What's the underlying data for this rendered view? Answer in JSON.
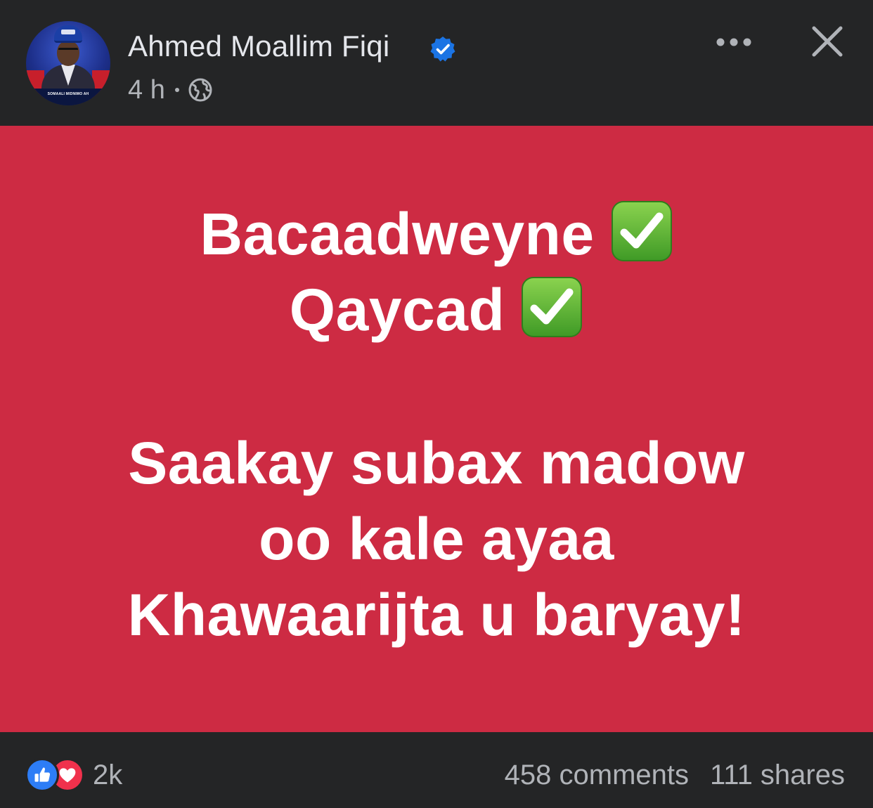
{
  "header": {
    "author_name": "Ahmed Moallim Fiqi",
    "timestamp": "4 h",
    "privacy_icon": "globe-icon",
    "verified_icon": "verified-badge-icon",
    "more_icon": "more-options-icon",
    "close_icon": "close-icon",
    "avatar_banner": "SOMAALI MIDNIMO AH"
  },
  "post": {
    "background_color": "#cd2b43",
    "text_color": "#ffffff",
    "lines": [
      "Bacaadweyne",
      "Qaycad",
      "Saakay subax madow",
      "oo kale ayaa",
      "Khawaarijta u baryay!"
    ],
    "check_icon": "check-mark-button-icon"
  },
  "footer": {
    "reactions": [
      "like-icon",
      "love-icon"
    ],
    "reaction_count": "2k",
    "comments": "458 comments",
    "shares": "111 shares"
  },
  "colors": {
    "page_background": "#242526",
    "primary_text": "#e4e6eb",
    "secondary_text": "#b0b3b8",
    "verified_blue": "#1b74e4",
    "like_blue": "#2d7df6",
    "love_red": "#f0314c",
    "check_green": "#5fb832"
  }
}
